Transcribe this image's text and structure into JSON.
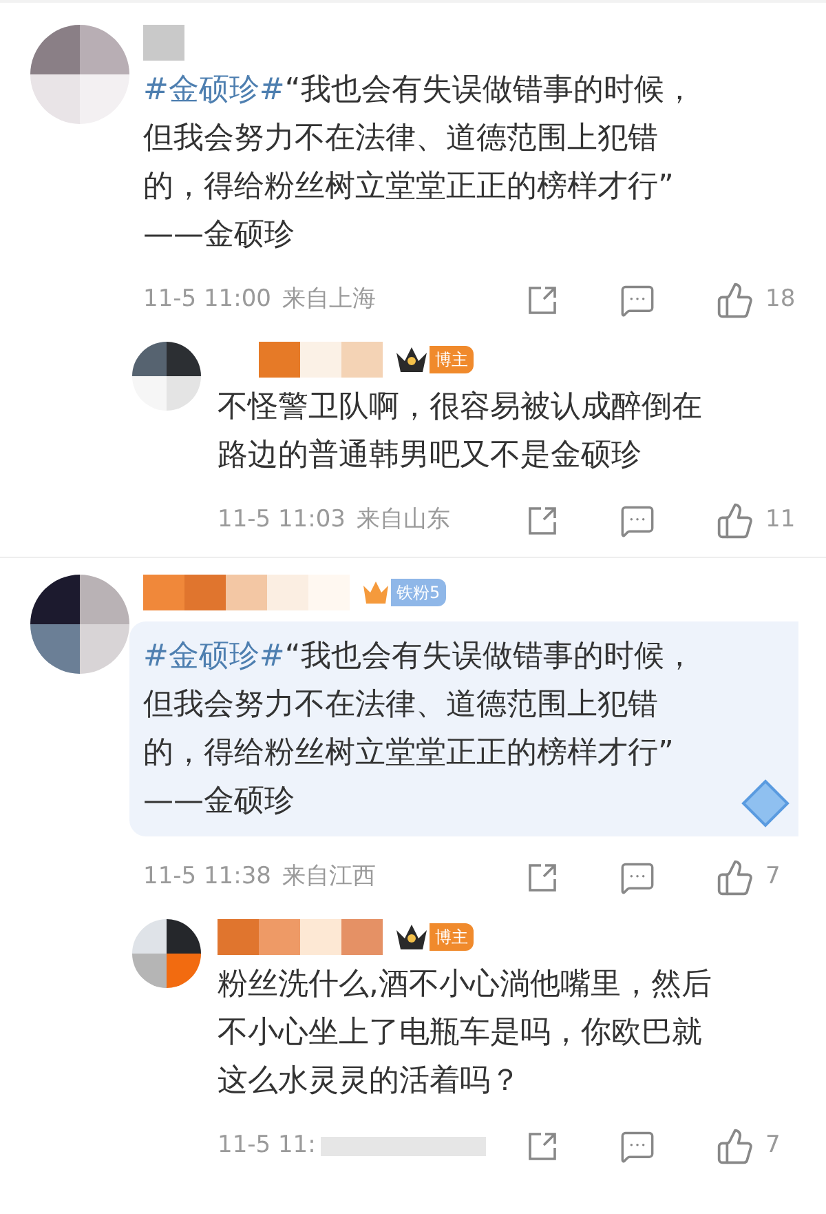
{
  "comments": [
    {
      "hashtag": "#金硕珍#",
      "lines": [
        "“我也会有失误做错事的时候，",
        "但我会努力不在法律、道德范围上犯错",
        "的，得给粉丝树立堂堂正正的榜样才行”",
        "——金硕珍"
      ],
      "highlighted": false,
      "time": "11-5 11:00",
      "location": "来自上海",
      "likes": "18",
      "replies": [
        {
          "badge": {
            "kind": "blogger",
            "label": "博主"
          },
          "lines": [
            "不怪警卫队啊，很容易被认成醉倒在",
            "路边的普通韩男吧又不是金硕珍"
          ],
          "time": "11-5 11:03",
          "location": "来自山东",
          "likes": "11"
        }
      ]
    },
    {
      "badge": {
        "kind": "fan",
        "label": "铁粉5"
      },
      "hashtag": "#金硕珍#",
      "lines": [
        "“我也会有失误做错事的时候，",
        "但我会努力不在法律、道德范围上犯错",
        "的，得给粉丝树立堂堂正正的榜样才行”",
        "——金硕珍"
      ],
      "highlighted": true,
      "time": "11-5 11:38",
      "location": "来自江西",
      "likes": "7",
      "replies": [
        {
          "badge": {
            "kind": "blogger",
            "label": "博主"
          },
          "lines": [
            "粉丝洗什么,酒不小心淌他嘴里，然后",
            "不小心坐上了电瓶车是吗，你欧巴就",
            "这么水灵灵的活着吗？"
          ],
          "time": "11-5 11:",
          "likes": "7"
        }
      ]
    }
  ]
}
